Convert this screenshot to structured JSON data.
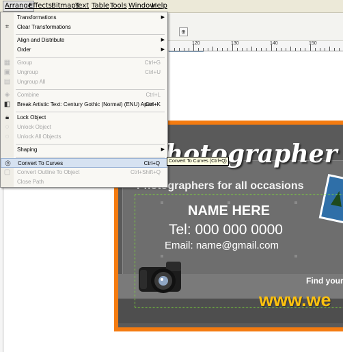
{
  "menubar": {
    "items": [
      "Arrange",
      "Effects",
      "Bitmaps",
      "Text",
      "Table",
      "Tools",
      "Window",
      "Help"
    ],
    "active": "Arrange"
  },
  "toolbar": {
    "icons": [
      "bold-icon",
      "italic-icon",
      "underline-icon",
      "align-icon",
      "bullets-icon",
      "dropcap-icon",
      "character-format-icon",
      "edit-text-icon"
    ]
  },
  "ruler": {
    "labels": [
      "120",
      "130",
      "140",
      "150"
    ]
  },
  "arrange_menu": {
    "items": [
      {
        "label": "Transformations",
        "shortcut": "",
        "submenu": true,
        "enabled": true,
        "icon": ""
      },
      {
        "label": "Clear Transformations",
        "shortcut": "",
        "submenu": false,
        "enabled": true,
        "icon": "clear-transform-icon"
      },
      {
        "label": "Align and Distribute",
        "shortcut": "",
        "submenu": true,
        "enabled": true,
        "icon": ""
      },
      {
        "label": "Order",
        "shortcut": "",
        "submenu": true,
        "enabled": true,
        "icon": ""
      },
      {
        "label": "Group",
        "shortcut": "Ctrl+G",
        "submenu": false,
        "enabled": false,
        "icon": "group-icon"
      },
      {
        "label": "Ungroup",
        "shortcut": "Ctrl+U",
        "submenu": false,
        "enabled": false,
        "icon": "ungroup-icon"
      },
      {
        "label": "Ungroup All",
        "shortcut": "",
        "submenu": false,
        "enabled": false,
        "icon": "ungroup-all-icon"
      },
      {
        "label": "Combine",
        "shortcut": "Ctrl+L",
        "submenu": false,
        "enabled": false,
        "icon": "combine-icon"
      },
      {
        "label": "Break Artistic Text: Century Gothic (Normal) (ENU) Apart",
        "shortcut": "Ctrl+K",
        "submenu": false,
        "enabled": true,
        "icon": "break-apart-icon"
      },
      {
        "label": "Lock Object",
        "shortcut": "",
        "submenu": false,
        "enabled": true,
        "icon": "lock-icon"
      },
      {
        "label": "Unlock Object",
        "shortcut": "",
        "submenu": false,
        "enabled": false,
        "icon": "unlock-icon"
      },
      {
        "label": "Unlock All Objects",
        "shortcut": "",
        "submenu": false,
        "enabled": false,
        "icon": "unlock-all-icon"
      },
      {
        "label": "Shaping",
        "shortcut": "",
        "submenu": true,
        "enabled": true,
        "icon": ""
      },
      {
        "label": "Convert To Curves",
        "shortcut": "Ctrl+Q",
        "submenu": false,
        "enabled": true,
        "icon": "convert-curves-icon",
        "highlighted": true
      },
      {
        "label": "Convert Outline To Object",
        "shortcut": "Ctrl+Shift+Q",
        "submenu": false,
        "enabled": false,
        "icon": "outline-object-icon"
      },
      {
        "label": "Close Path",
        "shortcut": "",
        "submenu": false,
        "enabled": false,
        "icon": ""
      }
    ]
  },
  "tooltip": "Convert To Curves (Ctrl+Q)",
  "card": {
    "title": "hotographer",
    "tagline": "Photographers for all occasions",
    "name": "NAME HERE",
    "tel": "Tel: 000 000 0000",
    "email": "Email: name@gmail.com",
    "find": "Find your",
    "website": "www.we",
    "colors": {
      "border": "#f47b10",
      "website": "#ffc20e",
      "selection": "#7cdc37"
    }
  }
}
